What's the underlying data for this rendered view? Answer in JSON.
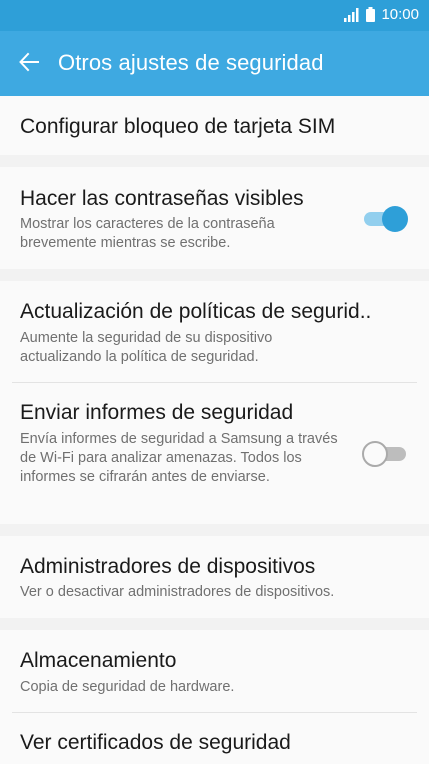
{
  "status_bar": {
    "time": "10:00"
  },
  "header": {
    "title": "Otros ajustes de seguridad"
  },
  "settings": {
    "sim_lock": {
      "title": "Configurar bloqueo de tarjeta SIM"
    },
    "visible_passwords": {
      "title": "Hacer las contraseñas visibles",
      "subtitle": "Mostrar los caracteres de la contraseña brevemente mientras se escribe.",
      "enabled": true
    },
    "policy_update": {
      "title": "Actualización de políticas de segurid..",
      "subtitle": "Aumente la seguridad de su dispositivo actualizando la política de seguridad."
    },
    "security_reports": {
      "title": "Enviar informes de seguridad",
      "subtitle": "Envía informes de seguridad a Samsung a través de Wi-Fi para analizar amenazas. Todos los informes se cifrarán antes de enviarse.",
      "enabled": false
    },
    "device_admins": {
      "title": "Administradores de dispositivos",
      "subtitle": "Ver o desactivar administradores de dispositivos."
    },
    "storage": {
      "title": "Almacenamiento",
      "subtitle": "Copia de seguridad de hardware."
    },
    "certificates": {
      "title": "Ver certificados de seguridad"
    }
  },
  "colors": {
    "accent": "#3ea9e1",
    "status_bar": "#2e9fd8",
    "background": "#f2f2f2"
  }
}
